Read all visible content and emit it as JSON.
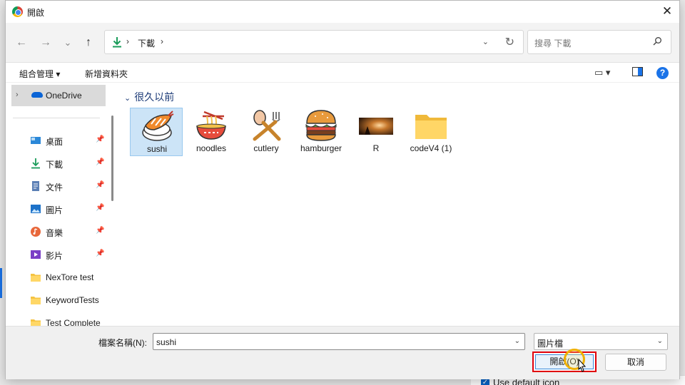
{
  "window": {
    "title": "開啟",
    "close_label": "✕"
  },
  "nav": {
    "back": "←",
    "forward": "→",
    "recent": "⌄",
    "up": "↑",
    "path": [
      "下載"
    ],
    "path_sep": "›",
    "search_placeholder": "搜尋 下載"
  },
  "toolbar": {
    "organize_label": "組合管理",
    "new_folder_label": "新增資料夾"
  },
  "sidebar": {
    "onedrive_label": "OneDrive",
    "items": [
      {
        "label": "桌面",
        "icon": "desktop-icon",
        "pinned": true
      },
      {
        "label": "下載",
        "icon": "download-icon",
        "pinned": true
      },
      {
        "label": "文件",
        "icon": "document-icon",
        "pinned": true
      },
      {
        "label": "圖片",
        "icon": "picture-icon",
        "pinned": true
      },
      {
        "label": "音樂",
        "icon": "music-icon",
        "pinned": true
      },
      {
        "label": "影片",
        "icon": "video-icon",
        "pinned": true
      },
      {
        "label": "NexTore test",
        "icon": "folder-icon",
        "pinned": false
      },
      {
        "label": "KeywordTests",
        "icon": "folder-icon",
        "pinned": false
      },
      {
        "label": "Test Complete",
        "icon": "folder-icon",
        "pinned": false
      }
    ]
  },
  "content": {
    "group_header": "很久以前",
    "files": [
      {
        "name": "sushi",
        "icon": "sushi-icon",
        "selected": true
      },
      {
        "name": "noodles",
        "icon": "noodles-icon",
        "selected": false
      },
      {
        "name": "cutlery",
        "icon": "cutlery-icon",
        "selected": false
      },
      {
        "name": "hamburger",
        "icon": "hamburger-icon",
        "selected": false
      },
      {
        "name": "R",
        "icon": "photo-thumbnail",
        "selected": false
      },
      {
        "name": "codeV4 (1)",
        "icon": "folder-icon",
        "selected": false
      }
    ]
  },
  "footer": {
    "filename_label": "檔案名稱(N):",
    "filename_value": "sushi",
    "filetype_value": "圖片檔",
    "open_label": "開啟(O)",
    "cancel_label": "取消"
  },
  "background": {
    "checkbox_label": "Use default icon"
  },
  "colors": {
    "accent": "#1a73e8",
    "highlight_border": "#e0000a",
    "selection": "#cce4f7"
  }
}
